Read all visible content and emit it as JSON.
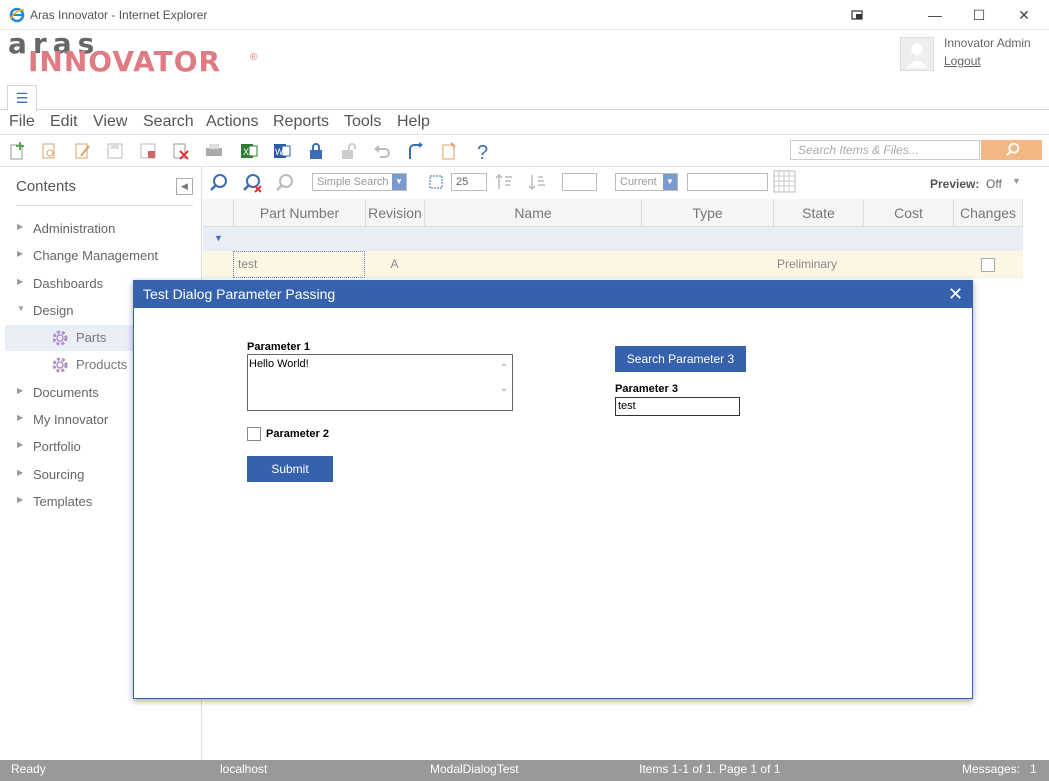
{
  "window": {
    "title": "Aras Innovator - Internet Explorer",
    "controls": [
      "—",
      "☐",
      "✕"
    ]
  },
  "header": {
    "logo_top": "aras",
    "logo_bottom": "INNOVATOR",
    "logo_reg": "®",
    "user_name": "Innovator Admin",
    "logout_label": "Logout"
  },
  "menubar": {
    "items": [
      "File",
      "Edit",
      "View",
      "Search",
      "Actions",
      "Reports",
      "Tools",
      "Help"
    ]
  },
  "toolbar": {
    "search_placeholder": "Search Items & Files..."
  },
  "sidebar": {
    "title": "Contents",
    "items": [
      "Administration",
      "Change Management",
      "Dashboards",
      "Design",
      "Documents",
      "My Innovator",
      "Portfolio",
      "Sourcing",
      "Templates"
    ],
    "design_children": [
      "Parts",
      "Products"
    ]
  },
  "searchbar": {
    "mode": "Simple Search",
    "page_size": "25",
    "revision": "Current",
    "preview_label": "Preview:",
    "preview_value": "Off"
  },
  "grid": {
    "columns": [
      "Part Number",
      "Revision",
      "Name",
      "Type",
      "State",
      "Cost",
      "Changes"
    ],
    "row": {
      "part_number": "test",
      "revision": "A",
      "state": "Preliminary"
    }
  },
  "dialog": {
    "title": "Test Dialog Parameter Passing",
    "param1_label": "Parameter 1",
    "param1_value": "Hello World!",
    "param2_label": "Parameter 2",
    "submit_label": "Submit",
    "search_button": "Search Parameter 3",
    "param3_label": "Parameter 3",
    "param3_value": "test"
  },
  "statusbar": {
    "status": "Ready",
    "server": "localhost",
    "database": "ModalDialogTest",
    "items": "Items 1-1 of 1. Page 1 of 1",
    "messages": "Messages:   1"
  },
  "colors": {
    "accent": "#3662ad",
    "logo_pink": "#e07b84",
    "search_btn": "#f3b883",
    "row_highlight": "#fbf7e4"
  }
}
